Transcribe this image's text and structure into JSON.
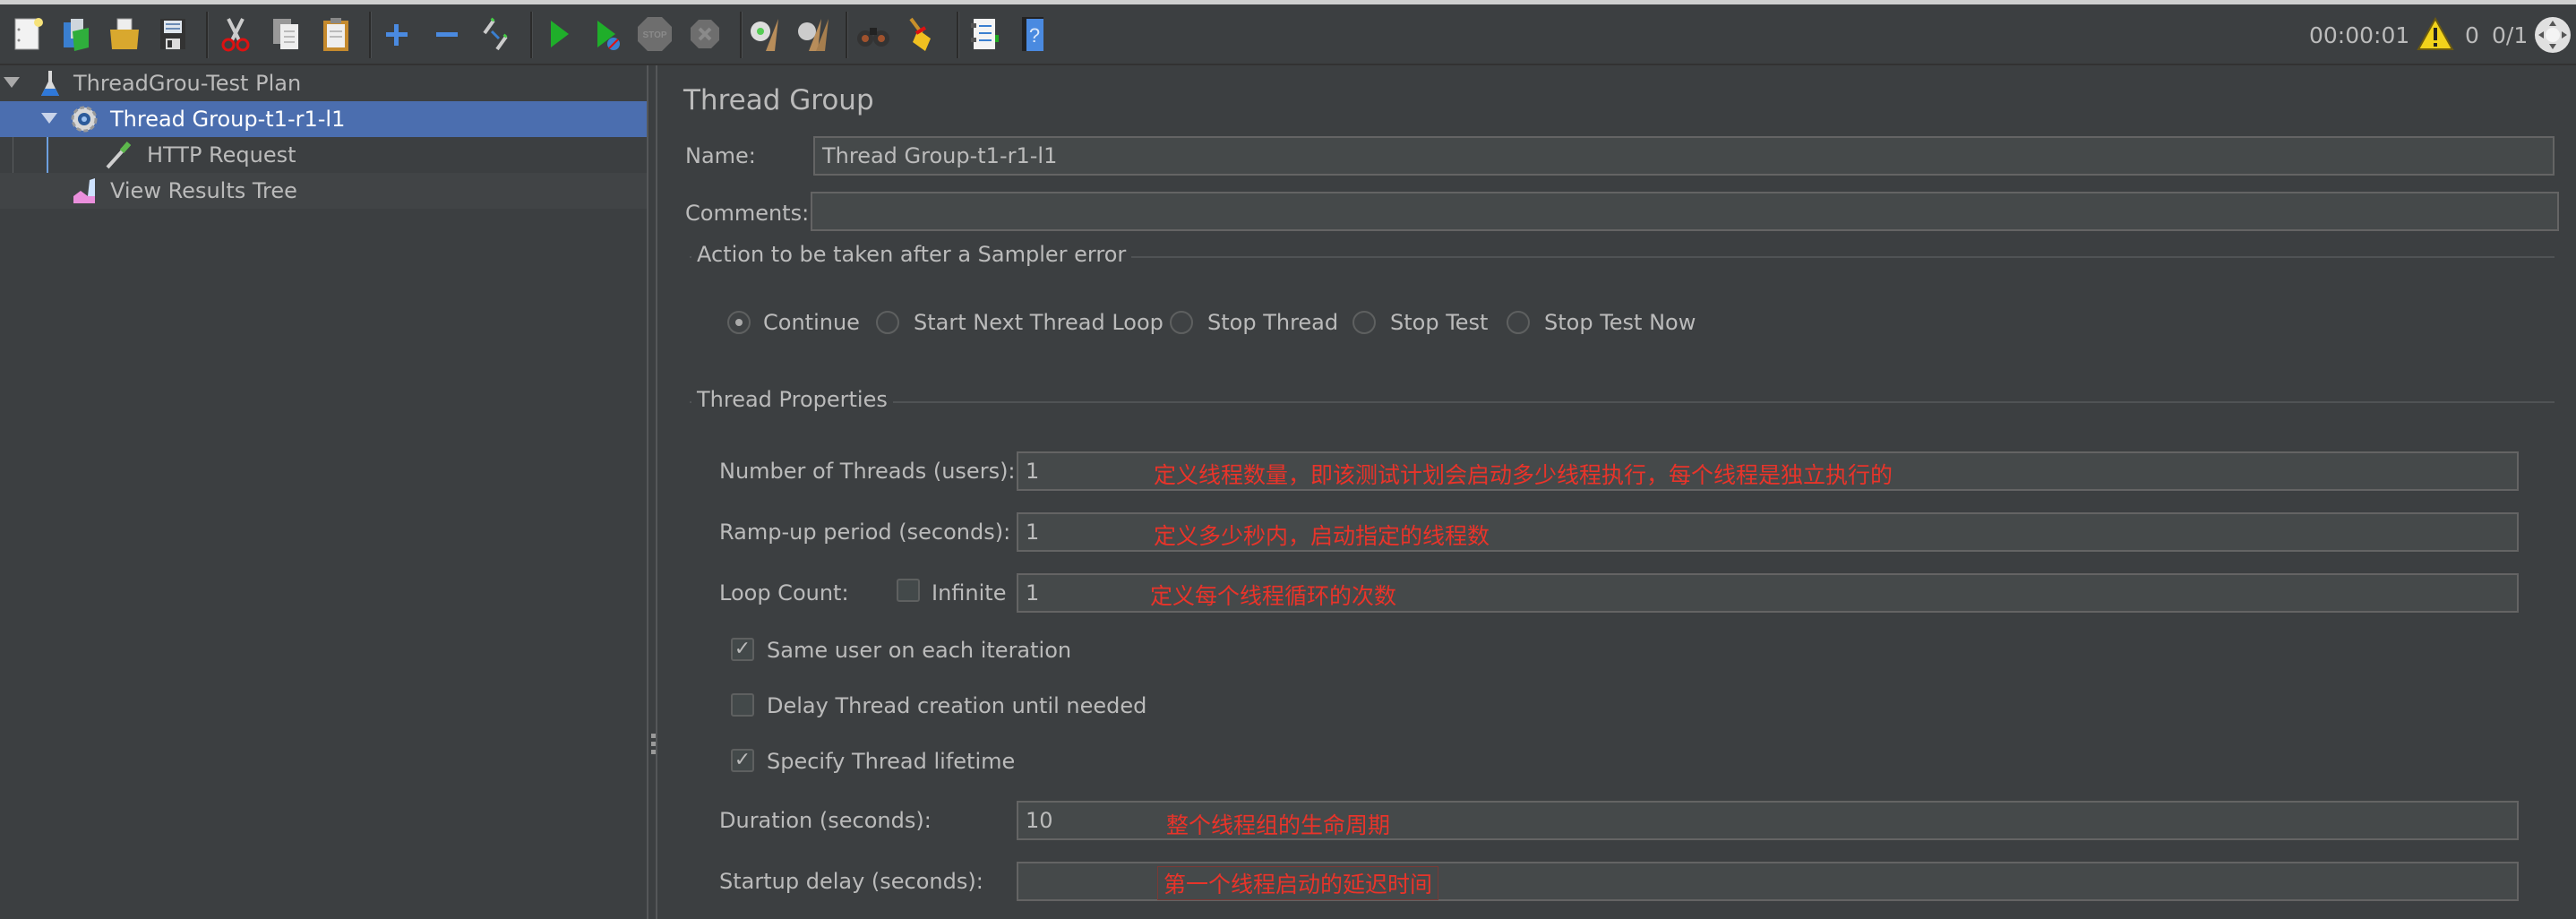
{
  "toolbar": {
    "buttons": [
      {
        "name": "new-icon",
        "tooltip": "New"
      },
      {
        "name": "templates-icon",
        "tooltip": "Templates"
      },
      {
        "name": "open-icon",
        "tooltip": "Open"
      },
      {
        "name": "save-icon",
        "tooltip": "Save"
      },
      {
        "name": "cut-icon",
        "tooltip": "Cut"
      },
      {
        "name": "copy-icon",
        "tooltip": "Copy"
      },
      {
        "name": "paste-icon",
        "tooltip": "Paste"
      },
      {
        "name": "expand-icon",
        "tooltip": "Expand All"
      },
      {
        "name": "collapse-icon",
        "tooltip": "Collapse All"
      },
      {
        "name": "toggle-icon",
        "tooltip": "Toggle"
      },
      {
        "name": "start-icon",
        "tooltip": "Start"
      },
      {
        "name": "start-no-pauses-icon",
        "tooltip": "Start no pauses"
      },
      {
        "name": "stop-icon",
        "tooltip": "Stop"
      },
      {
        "name": "shutdown-icon",
        "tooltip": "Shutdown"
      },
      {
        "name": "clear-icon",
        "tooltip": "Clear"
      },
      {
        "name": "clear-all-icon",
        "tooltip": "Clear All"
      },
      {
        "name": "search-icon",
        "tooltip": "Search"
      },
      {
        "name": "reset-search-icon",
        "tooltip": "Reset Search"
      },
      {
        "name": "function-helper-icon",
        "tooltip": "Function Helper Dialog"
      },
      {
        "name": "help-icon",
        "tooltip": "Help"
      }
    ],
    "status": {
      "elapsed": "00:00:01",
      "warnings": "0",
      "threads": "0/1"
    }
  },
  "tree": {
    "items": [
      {
        "label": "ThreadGrou-Test Plan",
        "icon": "test-plan-icon",
        "level": 0,
        "expanded": true,
        "selected": false
      },
      {
        "label": "Thread Group-t1-r1-l1",
        "icon": "thread-group-icon",
        "level": 1,
        "expanded": true,
        "selected": true
      },
      {
        "label": "HTTP Request",
        "icon": "http-sampler-icon",
        "level": 2,
        "selected": false
      },
      {
        "label": "View Results Tree",
        "icon": "results-tree-icon",
        "level": 1,
        "selected": false
      }
    ]
  },
  "main": {
    "title": "Thread Group",
    "name_label": "Name:",
    "name_value": "Thread Group-t1-r1-l1",
    "comments_label": "Comments:",
    "comments_value": "",
    "sampler_error": {
      "title": "Action to be taken after a Sampler error",
      "options": [
        "Continue",
        "Start Next Thread Loop",
        "Stop Thread",
        "Stop Test",
        "Stop Test Now"
      ],
      "selected": "Continue"
    },
    "thread_props": {
      "title": "Thread Properties",
      "num_threads_label": "Number of Threads (users):",
      "num_threads_value": "1",
      "num_threads_note": "定义线程数量，即该测试计划会启动多少线程执行，每个线程是独立执行的",
      "rampup_label": "Ramp-up period (seconds):",
      "rampup_value": "1",
      "rampup_note": "定义多少秒内，启动指定的线程数",
      "loop_label": "Loop Count:",
      "infinite_label": "Infinite",
      "infinite_checked": false,
      "loop_value": "1",
      "loop_note": "定义每个线程循环的次数",
      "same_user_label": "Same user on each iteration",
      "same_user_checked": true,
      "delay_label": "Delay Thread creation until needed",
      "delay_checked": false,
      "lifetime_label": "Specify Thread lifetime",
      "lifetime_checked": true,
      "duration_label": "Duration (seconds):",
      "duration_value": "10",
      "duration_note": "整个线程组的生命周期",
      "startup_label": "Startup delay (seconds):",
      "startup_value": "",
      "startup_note": "第一个线程启动的延迟时间"
    }
  },
  "colors": {
    "background": "#3c3f41",
    "selection": "#4b6eaf",
    "annotation": "#e8342a",
    "text": "#bbbbbb"
  }
}
